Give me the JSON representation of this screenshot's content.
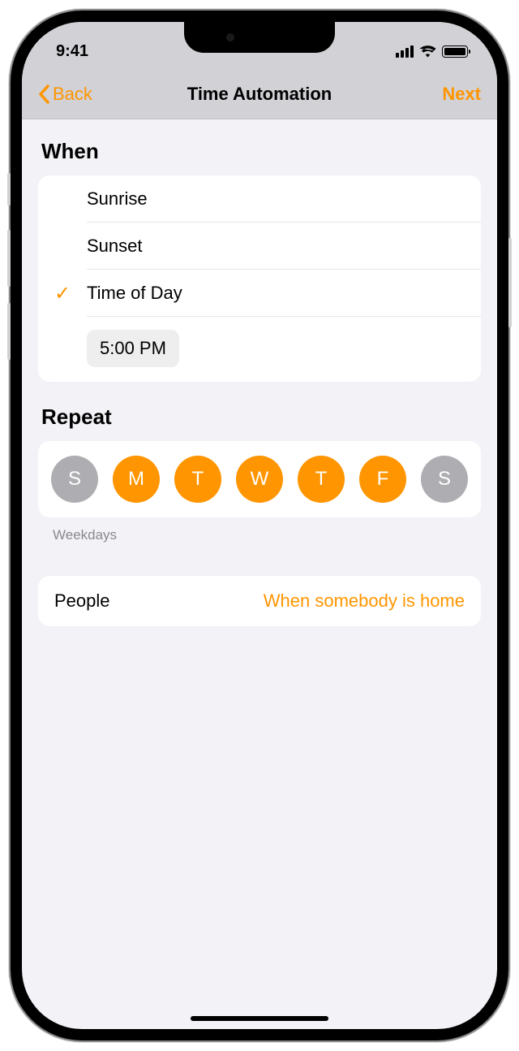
{
  "statusBar": {
    "time": "9:41"
  },
  "nav": {
    "back": "Back",
    "title": "Time Automation",
    "next": "Next"
  },
  "when": {
    "header": "When",
    "options": {
      "sunrise": "Sunrise",
      "sunset": "Sunset",
      "timeOfDay": "Time of Day"
    },
    "selectedTime": "5:00 PM"
  },
  "repeat": {
    "header": "Repeat",
    "days": [
      {
        "label": "S",
        "active": false
      },
      {
        "label": "M",
        "active": true
      },
      {
        "label": "T",
        "active": true
      },
      {
        "label": "W",
        "active": true
      },
      {
        "label": "T",
        "active": true
      },
      {
        "label": "F",
        "active": true
      },
      {
        "label": "S",
        "active": false
      }
    ],
    "caption": "Weekdays"
  },
  "people": {
    "label": "People",
    "value": "When somebody is home"
  },
  "colors": {
    "accent": "#ff9500",
    "inactive": "#aeaeb2",
    "background": "#f2f2f7"
  }
}
